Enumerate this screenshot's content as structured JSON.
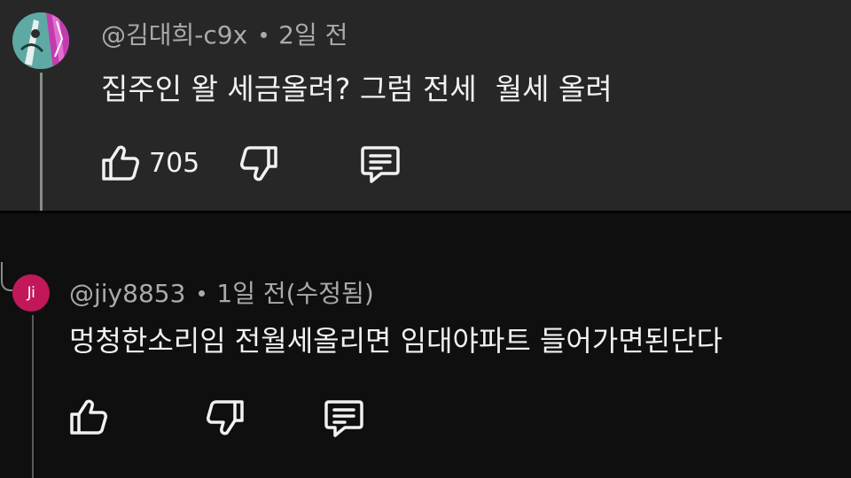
{
  "comments": [
    {
      "username": "@김대희-c9x",
      "time": "2일 전",
      "text": "집주인 왈 세금올려? 그럼 전세  월세 올려",
      "like_count": "705"
    },
    {
      "avatar_initials": "Ji",
      "username": "@jiy8853",
      "time": "1일 전(수정됨)",
      "text": "멍청한소리임 전월세올리면 임대야파트 들어가면된단다",
      "like_count": ""
    }
  ],
  "icons": {
    "like": "thumbs-up-icon",
    "dislike": "thumbs-down-icon",
    "reply": "reply-comment-icon"
  },
  "colors": {
    "top_panel_bg": "#272727",
    "page_bg": "#0f0f0f",
    "secondary_text": "#aaaaaa",
    "primary_text": "#f1f1f1",
    "reply_avatar_bg": "#c2185b"
  }
}
